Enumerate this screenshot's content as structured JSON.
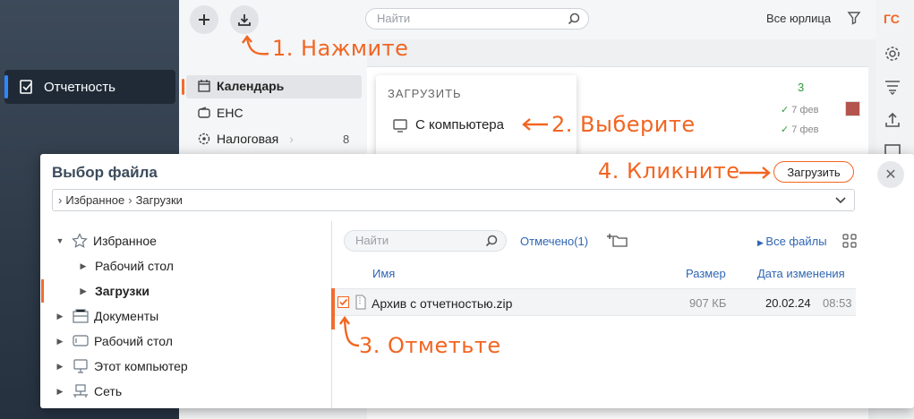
{
  "sidebar": {
    "items": [
      {
        "label": "Отчетность",
        "active": true
      }
    ]
  },
  "topbar": {
    "search_placeholder": "Найти",
    "entities_label": "Все юрлица",
    "avatar_text": "ГС"
  },
  "col2": {
    "items": [
      {
        "label": "Календарь",
        "active": true
      },
      {
        "label": "ЕНС"
      },
      {
        "label": "Налоговая",
        "count": "8"
      }
    ]
  },
  "upload_menu": {
    "header": "ЗАГРУЗИТЬ",
    "item": "С компьютера"
  },
  "feed": {
    "count": "3",
    "dates": [
      "7 фев",
      "7 фев"
    ]
  },
  "annotations": {
    "step1": "1. Нажмите",
    "step2": "2. Выберите",
    "step3": "3. Отметьте",
    "step4": "4. Кликните"
  },
  "dialog": {
    "title": "Выбор файла",
    "breadcrumb": [
      "Избранное",
      "Загрузки"
    ],
    "upload_button": "Загрузить",
    "tree": [
      {
        "label": "Избранное",
        "expanded": true
      },
      {
        "label": "Рабочий стол"
      },
      {
        "label": "Загрузки",
        "selected": true
      },
      {
        "label": "Документы"
      },
      {
        "label": "Рабочий стол"
      },
      {
        "label": "Этот компьютер"
      },
      {
        "label": "Сеть"
      }
    ],
    "search_placeholder": "Найти",
    "marked": "Отмечено(1)",
    "all_files": "Все файлы",
    "columns": {
      "name": "Имя",
      "size": "Размер",
      "date": "Дата изменения"
    },
    "files": [
      {
        "name": "Архив с отчетностью.zip",
        "size": "907 КБ",
        "date": "20.02.24",
        "time": "08:53",
        "checked": true
      }
    ]
  },
  "colors": {
    "accent": "#f26522",
    "link": "#2f66b3",
    "success": "#2e9a3e",
    "sidebar_bg": "#2e3a48"
  }
}
